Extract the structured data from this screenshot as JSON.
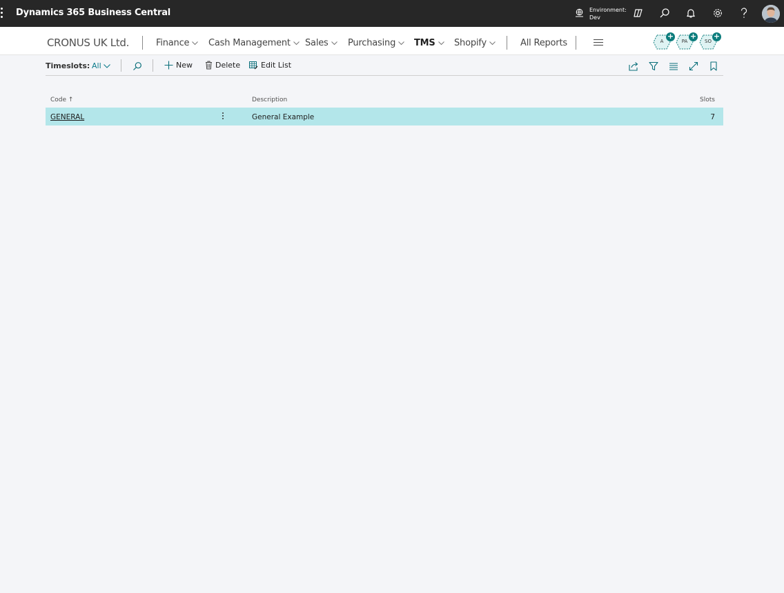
{
  "appbar": {
    "title": "Dynamics 365 Business Central",
    "environment_label": "Environment:",
    "environment_value": "Dev"
  },
  "nav": {
    "company": "CRONUS UK Ltd.",
    "menus": [
      "Finance",
      "Cash Management",
      "Sales",
      "Purchasing",
      "TMS",
      "Shopify"
    ],
    "all_reports": "All Reports",
    "quick_roles": [
      "A",
      "PA",
      "SO"
    ]
  },
  "actionbar": {
    "title": "Timeslots:",
    "filter": "All",
    "new_label": "New",
    "delete_label": "Delete",
    "edit_list_label": "Edit List"
  },
  "table": {
    "columns": {
      "code": "Code",
      "description": "Description",
      "slots": "Slots"
    },
    "sort_indicator": "↑",
    "rows": [
      {
        "code": "GENERAL",
        "description": "General Example",
        "slots": "7"
      }
    ]
  },
  "colors": {
    "accent": "#0c7c7c",
    "selected_row": "#b3e6ea",
    "appbar": "#272727"
  },
  "icons": [
    "waffle-icon",
    "environment-icon",
    "copilot-icon",
    "search-icon",
    "bell-icon",
    "gear-icon",
    "help-icon",
    "share-icon",
    "filter-icon",
    "list-view-icon",
    "expand-icon",
    "bookmark-icon",
    "plus-icon",
    "trash-icon",
    "edit-list-icon"
  ]
}
